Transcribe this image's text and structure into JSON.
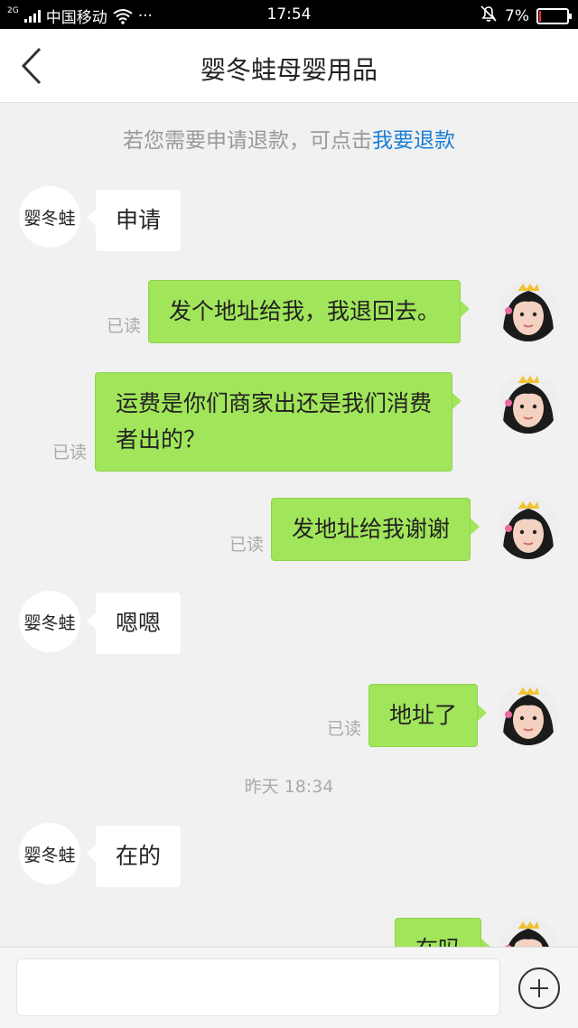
{
  "status_bar": {
    "network": "2G",
    "carrier": "中国移动",
    "more": "···",
    "time": "17:54",
    "battery": "7%",
    "battery_level": 0.07
  },
  "header": {
    "title": "婴冬蛙母婴用品"
  },
  "notice": {
    "text": "若您需要申请退款，可点击",
    "link": "我要退款"
  },
  "messages": [
    {
      "from": "shop",
      "avatar_text": "婴冬蛙",
      "text": "申请"
    },
    {
      "from": "me",
      "text": "发个地址给我，我退回去。",
      "read": "已读"
    },
    {
      "from": "me",
      "line1": "运费是你们商家出还是我们消费",
      "line2": "者出的？",
      "read": "已读"
    },
    {
      "from": "me",
      "text": "发地址给我谢谢",
      "read": "已读"
    },
    {
      "from": "shop",
      "avatar_text": "婴冬蛙",
      "text": "嗯嗯"
    },
    {
      "from": "me",
      "text": "地址了",
      "read": "已读"
    },
    {
      "timestamp": "昨天 18:34"
    },
    {
      "from": "shop",
      "avatar_text": "婴冬蛙",
      "text": "在的"
    },
    {
      "from": "me",
      "text": "在吗"
    }
  ],
  "input": {
    "placeholder": ""
  },
  "colors": {
    "outgoing_bubble": "#a1e65a",
    "link": "#1a7fd6",
    "battery_low": "#ff2b2b"
  },
  "icons": {
    "back": "chevron-left-icon",
    "add": "plus-circle-icon"
  }
}
